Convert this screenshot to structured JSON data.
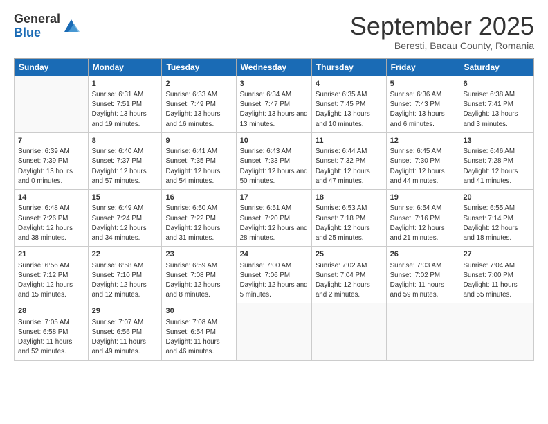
{
  "logo": {
    "general": "General",
    "blue": "Blue"
  },
  "title": "September 2025",
  "subtitle": "Beresti, Bacau County, Romania",
  "header_days": [
    "Sunday",
    "Monday",
    "Tuesday",
    "Wednesday",
    "Thursday",
    "Friday",
    "Saturday"
  ],
  "weeks": [
    [
      {
        "day": "",
        "info": ""
      },
      {
        "day": "1",
        "info": "Sunrise: 6:31 AM\nSunset: 7:51 PM\nDaylight: 13 hours\nand 19 minutes."
      },
      {
        "day": "2",
        "info": "Sunrise: 6:33 AM\nSunset: 7:49 PM\nDaylight: 13 hours\nand 16 minutes."
      },
      {
        "day": "3",
        "info": "Sunrise: 6:34 AM\nSunset: 7:47 PM\nDaylight: 13 hours\nand 13 minutes."
      },
      {
        "day": "4",
        "info": "Sunrise: 6:35 AM\nSunset: 7:45 PM\nDaylight: 13 hours\nand 10 minutes."
      },
      {
        "day": "5",
        "info": "Sunrise: 6:36 AM\nSunset: 7:43 PM\nDaylight: 13 hours\nand 6 minutes."
      },
      {
        "day": "6",
        "info": "Sunrise: 6:38 AM\nSunset: 7:41 PM\nDaylight: 13 hours\nand 3 minutes."
      }
    ],
    [
      {
        "day": "7",
        "info": "Sunrise: 6:39 AM\nSunset: 7:39 PM\nDaylight: 13 hours\nand 0 minutes."
      },
      {
        "day": "8",
        "info": "Sunrise: 6:40 AM\nSunset: 7:37 PM\nDaylight: 12 hours\nand 57 minutes."
      },
      {
        "day": "9",
        "info": "Sunrise: 6:41 AM\nSunset: 7:35 PM\nDaylight: 12 hours\nand 54 minutes."
      },
      {
        "day": "10",
        "info": "Sunrise: 6:43 AM\nSunset: 7:33 PM\nDaylight: 12 hours\nand 50 minutes."
      },
      {
        "day": "11",
        "info": "Sunrise: 6:44 AM\nSunset: 7:32 PM\nDaylight: 12 hours\nand 47 minutes."
      },
      {
        "day": "12",
        "info": "Sunrise: 6:45 AM\nSunset: 7:30 PM\nDaylight: 12 hours\nand 44 minutes."
      },
      {
        "day": "13",
        "info": "Sunrise: 6:46 AM\nSunset: 7:28 PM\nDaylight: 12 hours\nand 41 minutes."
      }
    ],
    [
      {
        "day": "14",
        "info": "Sunrise: 6:48 AM\nSunset: 7:26 PM\nDaylight: 12 hours\nand 38 minutes."
      },
      {
        "day": "15",
        "info": "Sunrise: 6:49 AM\nSunset: 7:24 PM\nDaylight: 12 hours\nand 34 minutes."
      },
      {
        "day": "16",
        "info": "Sunrise: 6:50 AM\nSunset: 7:22 PM\nDaylight: 12 hours\nand 31 minutes."
      },
      {
        "day": "17",
        "info": "Sunrise: 6:51 AM\nSunset: 7:20 PM\nDaylight: 12 hours\nand 28 minutes."
      },
      {
        "day": "18",
        "info": "Sunrise: 6:53 AM\nSunset: 7:18 PM\nDaylight: 12 hours\nand 25 minutes."
      },
      {
        "day": "19",
        "info": "Sunrise: 6:54 AM\nSunset: 7:16 PM\nDaylight: 12 hours\nand 21 minutes."
      },
      {
        "day": "20",
        "info": "Sunrise: 6:55 AM\nSunset: 7:14 PM\nDaylight: 12 hours\nand 18 minutes."
      }
    ],
    [
      {
        "day": "21",
        "info": "Sunrise: 6:56 AM\nSunset: 7:12 PM\nDaylight: 12 hours\nand 15 minutes."
      },
      {
        "day": "22",
        "info": "Sunrise: 6:58 AM\nSunset: 7:10 PM\nDaylight: 12 hours\nand 12 minutes."
      },
      {
        "day": "23",
        "info": "Sunrise: 6:59 AM\nSunset: 7:08 PM\nDaylight: 12 hours\nand 8 minutes."
      },
      {
        "day": "24",
        "info": "Sunrise: 7:00 AM\nSunset: 7:06 PM\nDaylight: 12 hours\nand 5 minutes."
      },
      {
        "day": "25",
        "info": "Sunrise: 7:02 AM\nSunset: 7:04 PM\nDaylight: 12 hours\nand 2 minutes."
      },
      {
        "day": "26",
        "info": "Sunrise: 7:03 AM\nSunset: 7:02 PM\nDaylight: 11 hours\nand 59 minutes."
      },
      {
        "day": "27",
        "info": "Sunrise: 7:04 AM\nSunset: 7:00 PM\nDaylight: 11 hours\nand 55 minutes."
      }
    ],
    [
      {
        "day": "28",
        "info": "Sunrise: 7:05 AM\nSunset: 6:58 PM\nDaylight: 11 hours\nand 52 minutes."
      },
      {
        "day": "29",
        "info": "Sunrise: 7:07 AM\nSunset: 6:56 PM\nDaylight: 11 hours\nand 49 minutes."
      },
      {
        "day": "30",
        "info": "Sunrise: 7:08 AM\nSunset: 6:54 PM\nDaylight: 11 hours\nand 46 minutes."
      },
      {
        "day": "",
        "info": ""
      },
      {
        "day": "",
        "info": ""
      },
      {
        "day": "",
        "info": ""
      },
      {
        "day": "",
        "info": ""
      }
    ]
  ]
}
